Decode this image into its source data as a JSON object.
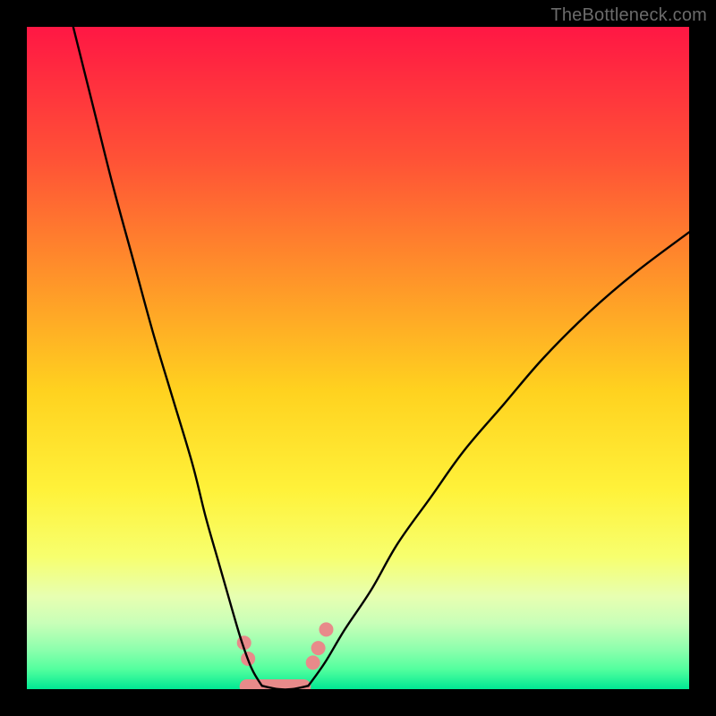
{
  "watermark": "TheBottleneck.com",
  "chart_data": {
    "type": "line",
    "title": "",
    "xlabel": "",
    "ylabel": "",
    "xlim": [
      0,
      100
    ],
    "ylim": [
      0,
      100
    ],
    "grid": false,
    "legend": false,
    "description": "Bottleneck V-curve on a vertical rainbow gradient background (red at top through orange/yellow to green at bottom). Two black curves descend steeply from upper-left and upper-right and meet near the bottom in a flat minimum. A pink highlight marks the minimum region.",
    "gradient_stops": [
      {
        "offset": 0.0,
        "color": "#ff1744"
      },
      {
        "offset": 0.2,
        "color": "#ff5236"
      },
      {
        "offset": 0.4,
        "color": "#ff9b28"
      },
      {
        "offset": 0.55,
        "color": "#ffd21f"
      },
      {
        "offset": 0.7,
        "color": "#fff23a"
      },
      {
        "offset": 0.8,
        "color": "#f7ff6e"
      },
      {
        "offset": 0.86,
        "color": "#e7ffb1"
      },
      {
        "offset": 0.9,
        "color": "#c9ffb8"
      },
      {
        "offset": 0.94,
        "color": "#8dffad"
      },
      {
        "offset": 0.97,
        "color": "#53ff9e"
      },
      {
        "offset": 1.0,
        "color": "#00e893"
      }
    ],
    "series": [
      {
        "name": "left-branch",
        "x": [
          7,
          10,
          13,
          16,
          19,
          22,
          25,
          27,
          29,
          31,
          32.5,
          34,
          35.5
        ],
        "y": [
          100,
          88,
          76,
          65,
          54,
          44,
          34,
          26,
          19,
          12,
          7,
          3,
          0.5
        ]
      },
      {
        "name": "right-branch",
        "x": [
          42.5,
          45,
          48,
          52,
          56,
          61,
          66,
          72,
          78,
          85,
          92,
          100
        ],
        "y": [
          0.5,
          4,
          9,
          15,
          22,
          29,
          36,
          43,
          50,
          57,
          63,
          69
        ]
      },
      {
        "name": "flat-minimum",
        "x": [
          35.5,
          38,
          40,
          42.5
        ],
        "y": [
          0.5,
          0,
          0,
          0.5
        ]
      }
    ],
    "highlight": {
      "color": "#e88a8a",
      "segment_x": [
        33.2,
        41.8
      ],
      "dots": [
        {
          "x": 32.8,
          "y": 7.0
        },
        {
          "x": 33.4,
          "y": 4.6
        },
        {
          "x": 43.2,
          "y": 4.0
        },
        {
          "x": 44.0,
          "y": 6.2
        },
        {
          "x": 45.2,
          "y": 9.0
        }
      ]
    }
  }
}
